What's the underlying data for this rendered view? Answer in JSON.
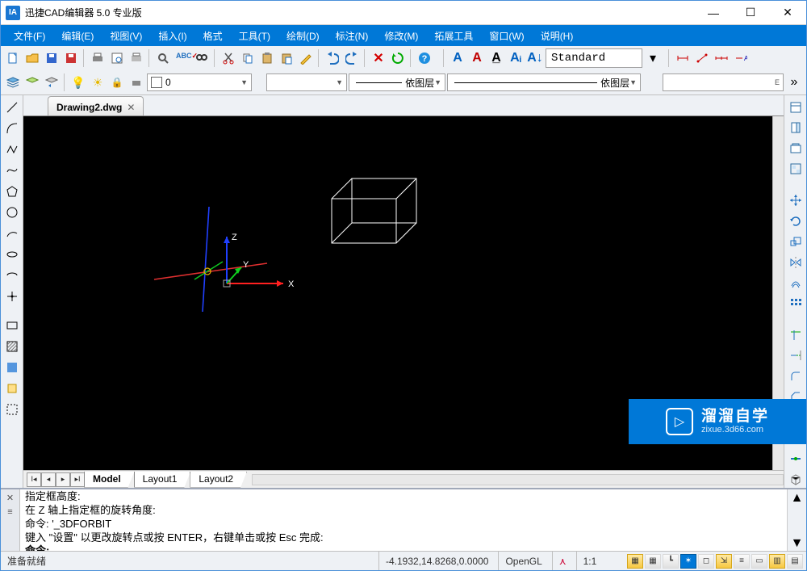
{
  "app": {
    "title": "迅捷CAD编辑器 5.0 专业版",
    "icon_letter": "IA"
  },
  "window_controls": {
    "min": "—",
    "max": "☐",
    "close": "✕"
  },
  "menu": {
    "items": [
      "文件(F)",
      "编辑(E)",
      "视图(V)",
      "插入(I)",
      "格式",
      "工具(T)",
      "绘制(D)",
      "标注(N)",
      "修改(M)",
      "拓展工具",
      "窗口(W)",
      "说明(H)"
    ]
  },
  "text_style": {
    "value": "Standard"
  },
  "layer": {
    "current": "0",
    "linetype": "依图层",
    "lineweight": "依图层"
  },
  "doc_tab": {
    "name": "Drawing2.dwg"
  },
  "model_tabs": {
    "active": "Model",
    "layouts": [
      "Layout1",
      "Layout2"
    ]
  },
  "command_log": {
    "l1": "指定框高度:",
    "l2": "在 Z 轴上指定框的旋转角度:",
    "l3": "命令: '_3DFORBIT",
    "l4": "键入 \"设置\" 以更改旋转点或按 ENTER，右键单击或按 Esc 完成:",
    "prompt": "命令:"
  },
  "status": {
    "ready": "准备就绪",
    "coords": "-4.1932,14.8268,0.0000",
    "renderer": "OpenGL",
    "scale": "1:1"
  },
  "axis_labels": {
    "x": "X",
    "y": "Y",
    "z": "Z"
  },
  "watermark": {
    "main": "溜溜自学",
    "sub": "zixue.3d66.com"
  }
}
